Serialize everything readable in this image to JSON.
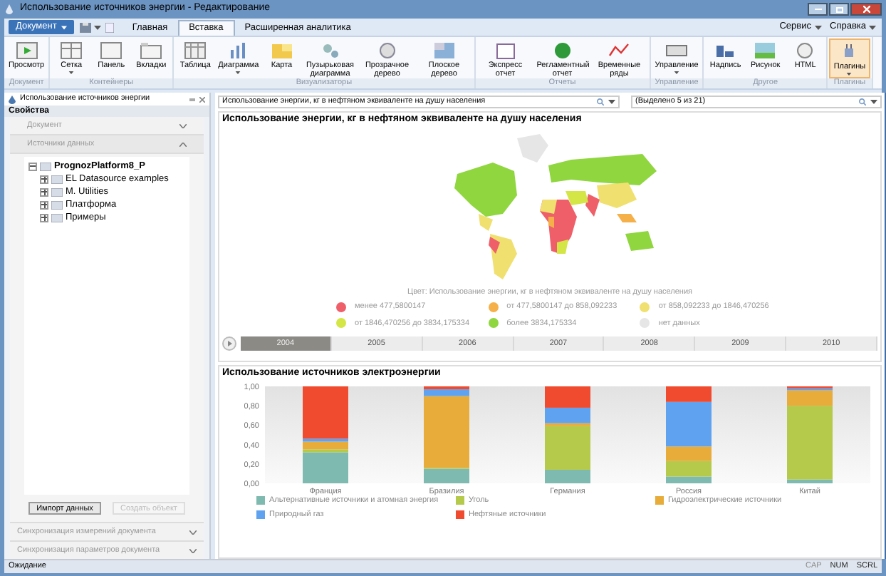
{
  "window": {
    "title": "Использование источников энергии - Редактирование"
  },
  "menu": {
    "document_button": "Документ",
    "tabs": [
      {
        "label": "Главная",
        "selected": false
      },
      {
        "label": "Вставка",
        "selected": true
      },
      {
        "label": "Расширенная аналитика",
        "selected": false
      }
    ],
    "right_items": [
      "Сервис",
      "Справка"
    ]
  },
  "ribbon": {
    "groups": [
      {
        "label": "Документ",
        "buttons": [
          {
            "label": "Просмотр",
            "dropdown": false,
            "selected": false
          }
        ]
      },
      {
        "label": "Контейнеры",
        "buttons": [
          {
            "label": "Сетка",
            "dropdown": true,
            "selected": false
          },
          {
            "label": "Панель",
            "dropdown": false,
            "selected": false
          },
          {
            "label": "Вкладки",
            "dropdown": false,
            "selected": false
          }
        ]
      },
      {
        "label": "Визуализаторы",
        "buttons": [
          {
            "label": "Таблица",
            "dropdown": false,
            "selected": false
          },
          {
            "label": "Диаграмма",
            "dropdown": true,
            "selected": false
          },
          {
            "label": "Карта",
            "dropdown": false,
            "selected": false
          },
          {
            "label": "Пузырьковая диаграмма",
            "dropdown": false,
            "selected": false
          },
          {
            "label": "Прозрачное дерево",
            "dropdown": false,
            "selected": false
          },
          {
            "label": "Плоское дерево",
            "dropdown": false,
            "selected": false
          }
        ]
      },
      {
        "label": "Отчеты",
        "buttons": [
          {
            "label": "Экспресс отчет",
            "dropdown": false,
            "selected": false
          },
          {
            "label": "Регламентный отчет",
            "dropdown": false,
            "selected": false
          },
          {
            "label": "Временные ряды",
            "dropdown": false,
            "selected": false
          }
        ]
      },
      {
        "label": "Управление",
        "buttons": [
          {
            "label": "Управление",
            "dropdown": true,
            "selected": false
          }
        ]
      },
      {
        "label": "Другое",
        "buttons": [
          {
            "label": "Надпись",
            "dropdown": false,
            "selected": false
          },
          {
            "label": "Рисунок",
            "dropdown": false,
            "selected": false
          },
          {
            "label": "HTML",
            "dropdown": false,
            "selected": false
          }
        ]
      },
      {
        "label": "Плагины",
        "buttons": [
          {
            "label": "Плагины",
            "dropdown": true,
            "selected": true
          }
        ]
      }
    ]
  },
  "side_panel": {
    "title": "Использование источников энергии",
    "properties_label": "Свойства",
    "sections": [
      {
        "label": "Документ",
        "expanded": false
      },
      {
        "label": "Источники данных",
        "expanded": true
      }
    ],
    "tree": [
      {
        "label": "PrognozPlatform8_P",
        "expanded": true,
        "children": [
          {
            "label": "EL Datasource examples",
            "expanded": false
          },
          {
            "label": "M. Utilities",
            "expanded": false
          },
          {
            "label": "Платформа",
            "expanded": false
          },
          {
            "label": "Примеры",
            "expanded": false
          }
        ]
      }
    ],
    "buttons": [
      {
        "label": "Импорт данных",
        "disabled": false
      },
      {
        "label": "Создать объект",
        "disabled": true
      }
    ],
    "bottom_sections": [
      {
        "label": "Синхронизация измерений документа",
        "expanded": false
      },
      {
        "label": "Синхронизация параметров документа",
        "expanded": false
      }
    ]
  },
  "filters": [
    {
      "value": "Использование энергии, кг в нефтяном эквиваленте на душу населения"
    },
    {
      "value": "(Выделено 5 из 21)"
    }
  ],
  "map_panel": {
    "title": "Использование энергии, кг в нефтяном эквиваленте на душу населения",
    "legend_caption": "Цвет: Использование энергии, кг в нефтяном эквиваленте на душу населения",
    "legend": [
      {
        "label": "менее 477,5800147",
        "color": "#ee5f6a"
      },
      {
        "label": "от 477,5800147 до 858,092233",
        "color": "#f5b04a"
      },
      {
        "label": "от 858,092233 до 1846,470256",
        "color": "#f0e070"
      },
      {
        "label": "от 1846,470256 до 3834,175334",
        "color": "#d4e645"
      },
      {
        "label": "более 3834,175334",
        "color": "#8fd63f"
      },
      {
        "label": "нет данных",
        "color": "#e6e6e6"
      }
    ],
    "timeline": [
      {
        "label": "2004",
        "selected": true
      },
      {
        "label": "2005",
        "selected": false
      },
      {
        "label": "2006",
        "selected": false
      },
      {
        "label": "2007",
        "selected": false
      },
      {
        "label": "2008",
        "selected": false
      },
      {
        "label": "2009",
        "selected": false
      },
      {
        "label": "2010",
        "selected": false
      }
    ]
  },
  "chart_panel": {
    "title": "Использование источников электроэнергии",
    "chart_data": {
      "type": "bar",
      "stacked": true,
      "legend": true,
      "categories": [
        "Франция",
        "Бразилия",
        "Германия",
        "Россия",
        "Китай"
      ],
      "ylim": [
        0,
        1
      ],
      "yticks": [
        {
          "value": 0,
          "label": "0,00"
        },
        {
          "value": 0.2,
          "label": "0,20"
        },
        {
          "value": 0.4,
          "label": "0,40"
        },
        {
          "value": 0.6,
          "label": "0,60"
        },
        {
          "value": 0.8,
          "label": "0,80"
        },
        {
          "value": 1,
          "label": "1,00"
        }
      ],
      "series": [
        {
          "name": "Альтернативные источники и атомная энергия",
          "color": "#7fbab0",
          "values": [
            0.32,
            0.15,
            0.14,
            0.07,
            0.04
          ]
        },
        {
          "name": "Уголь",
          "color": "#b5c94a",
          "values": [
            0.03,
            0.01,
            0.45,
            0.16,
            0.76
          ]
        },
        {
          "name": "Гидроэлектрические источники",
          "color": "#e8ac3a",
          "values": [
            0.08,
            0.74,
            0.03,
            0.15,
            0.16
          ]
        },
        {
          "name": "Природный газ",
          "color": "#5fa3f0",
          "values": [
            0.03,
            0.07,
            0.16,
            0.46,
            0.02
          ]
        },
        {
          "name": "Нефтяные источники",
          "color": "#f04a2f",
          "values": [
            0.54,
            0.03,
            0.22,
            0.16,
            0.02
          ]
        }
      ]
    }
  },
  "status_bar": {
    "text": "Ожидание",
    "indicators": [
      {
        "label": "CAP",
        "on": false
      },
      {
        "label": "NUM",
        "on": true
      },
      {
        "label": "SCRL",
        "on": true
      }
    ]
  }
}
